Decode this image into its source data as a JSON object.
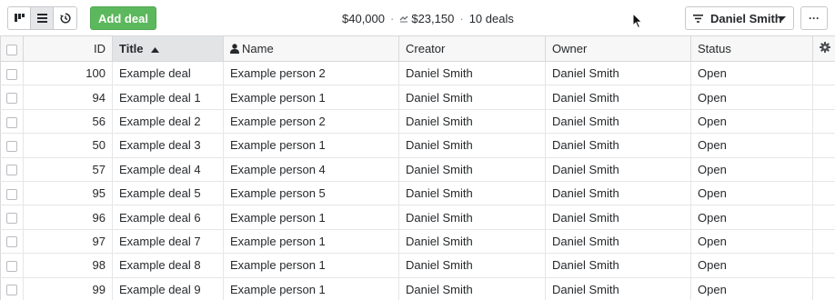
{
  "toolbar": {
    "add_deal_label": "Add deal",
    "summary_value": "$40,000",
    "summary_weighted": "$23,150",
    "summary_count": "10 deals",
    "summary_sep": "·",
    "filter_label": "Daniel Smith",
    "more_label": "···"
  },
  "table": {
    "columns": {
      "id": "ID",
      "title": "Title",
      "name": "Name",
      "creator": "Creator",
      "owner": "Owner",
      "status": "Status"
    },
    "rows": [
      {
        "id": "100",
        "title": "Example deal",
        "name": "Example person 2",
        "creator": "Daniel Smith",
        "owner": "Daniel Smith",
        "status": "Open"
      },
      {
        "id": "94",
        "title": "Example deal 1",
        "name": "Example person 1",
        "creator": "Daniel Smith",
        "owner": "Daniel Smith",
        "status": "Open"
      },
      {
        "id": "56",
        "title": "Example deal 2",
        "name": "Example person 2",
        "creator": "Daniel Smith",
        "owner": "Daniel Smith",
        "status": "Open"
      },
      {
        "id": "50",
        "title": "Example deal 3",
        "name": "Example person 1",
        "creator": "Daniel Smith",
        "owner": "Daniel Smith",
        "status": "Open"
      },
      {
        "id": "57",
        "title": "Example deal 4",
        "name": "Example person 4",
        "creator": "Daniel Smith",
        "owner": "Daniel Smith",
        "status": "Open"
      },
      {
        "id": "95",
        "title": "Example deal 5",
        "name": "Example person 5",
        "creator": "Daniel Smith",
        "owner": "Daniel Smith",
        "status": "Open"
      },
      {
        "id": "96",
        "title": "Example deal 6",
        "name": "Example person 1",
        "creator": "Daniel Smith",
        "owner": "Daniel Smith",
        "status": "Open"
      },
      {
        "id": "97",
        "title": "Example deal 7",
        "name": "Example person 1",
        "creator": "Daniel Smith",
        "owner": "Daniel Smith",
        "status": "Open"
      },
      {
        "id": "98",
        "title": "Example deal 8",
        "name": "Example person 1",
        "creator": "Daniel Smith",
        "owner": "Daniel Smith",
        "status": "Open"
      },
      {
        "id": "99",
        "title": "Example deal 9",
        "name": "Example person 1",
        "creator": "Daniel Smith",
        "owner": "Daniel Smith",
        "status": "Open"
      }
    ]
  },
  "icons": {
    "pipeline_view": "pipeline-view-icon",
    "list_view": "list-view-icon",
    "forecast_view": "forecast-view-icon",
    "filter": "filter-icon",
    "caret": "caret-down-icon",
    "person": "person-icon",
    "sort": "sort-ascending-icon",
    "gear": "gear-icon",
    "weighted": "weighted-value-icon",
    "cursor": "mouse-cursor-icon"
  },
  "colors": {
    "accent": "#5cb85c",
    "header_bg": "#f7f7f7",
    "sorted_header_bg": "#e3e4e6"
  }
}
